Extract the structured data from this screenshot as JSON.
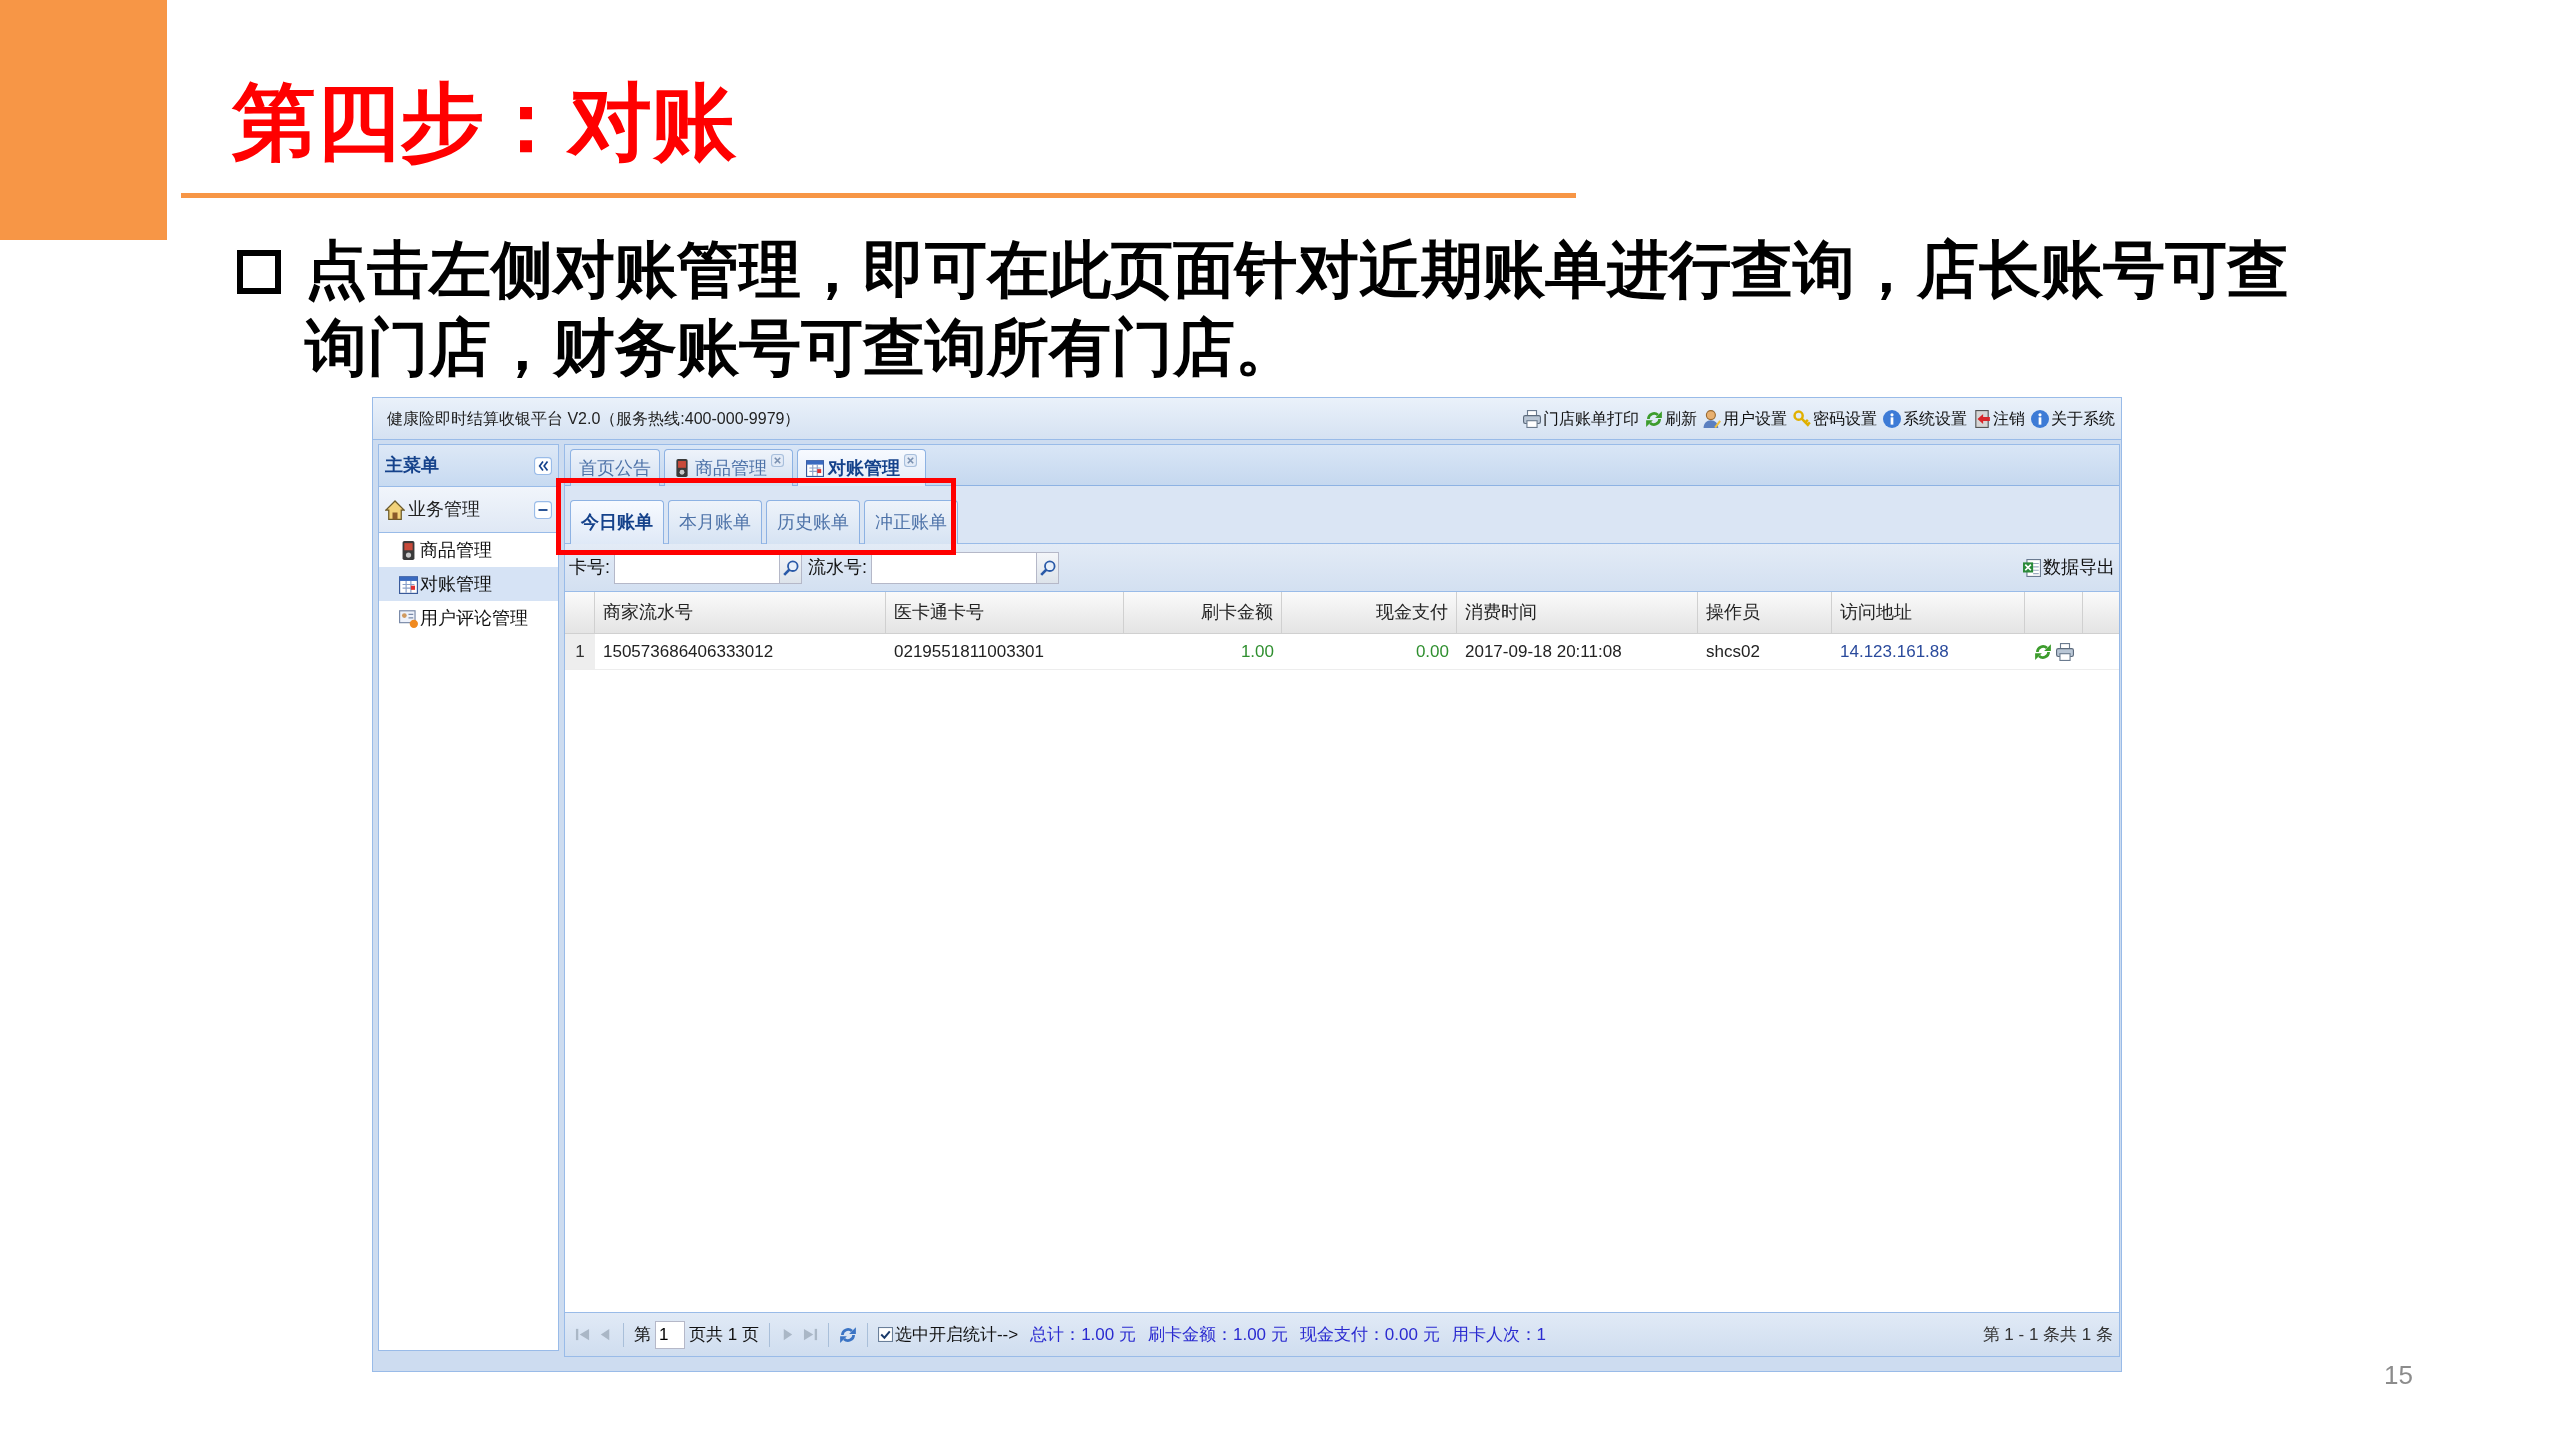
{
  "slide": {
    "title": "第四步：对账",
    "bullet": "点击左侧对账管理，即可在此页面针对近期账单进行查询，店长账号可查询门店，财务账号可查询所有门店。",
    "page_number": "15"
  },
  "app": {
    "title": "健康险即时结算收银平台 V2.0（服务热线:400-000-9979）",
    "toolbar": [
      {
        "kind": "print",
        "label": "门店账单打印"
      },
      {
        "kind": "refresh",
        "label": "刷新"
      },
      {
        "kind": "user",
        "label": "用户设置"
      },
      {
        "kind": "password",
        "label": "密码设置"
      },
      {
        "kind": "settings",
        "label": "系统设置"
      },
      {
        "kind": "logout",
        "label": "注销"
      },
      {
        "kind": "about",
        "label": "关于系统"
      }
    ]
  },
  "sidebar": {
    "title": "主菜单",
    "groups": [
      {
        "label": "业务管理",
        "expanded": true,
        "items": [
          {
            "kind": "product",
            "label": "商品管理",
            "selected": false
          },
          {
            "kind": "bill",
            "label": "对账管理",
            "selected": true
          },
          {
            "kind": "comment",
            "label": "用户评论管理",
            "selected": false
          }
        ]
      }
    ]
  },
  "tabs": [
    {
      "kind": "home",
      "label": "首页公告",
      "selected": false,
      "closable": false
    },
    {
      "kind": "product",
      "label": "商品管理",
      "selected": false,
      "closable": true
    },
    {
      "kind": "bill",
      "label": "对账管理",
      "selected": true,
      "closable": true
    }
  ],
  "sub_tabs": [
    {
      "label": "今日账单",
      "selected": true
    },
    {
      "label": "本月账单",
      "selected": false
    },
    {
      "label": "历史账单",
      "selected": false
    },
    {
      "label": "冲正账单",
      "selected": false
    }
  ],
  "filters": [
    {
      "label": "卡号:"
    },
    {
      "label": "流水号:"
    }
  ],
  "export_button": "数据导出",
  "table": {
    "columns": [
      "商家流水号",
      "医卡通卡号",
      "刷卡金额",
      "现金支付",
      "消费时间",
      "操作员",
      "访问地址"
    ],
    "rows": [
      {
        "number": "1",
        "cells": [
          "150573686406333012",
          "0219551811003301",
          "1.00",
          "0.00",
          "2017-09-18 20:11:08",
          "shcs02",
          "14.123.161.88"
        ]
      }
    ]
  },
  "pager": {
    "before_page": "第",
    "page": "1",
    "after_page": "页共 1 页",
    "statistics": {
      "checked": true,
      "label": "选中开启统计-->",
      "totals": [
        "总计：1.00 元",
        "刷卡金额：1.00 元",
        "现金支付：0.00 元",
        "用卡人次：1"
      ]
    },
    "display_info": "第 1 - 1 条共 1 条"
  }
}
